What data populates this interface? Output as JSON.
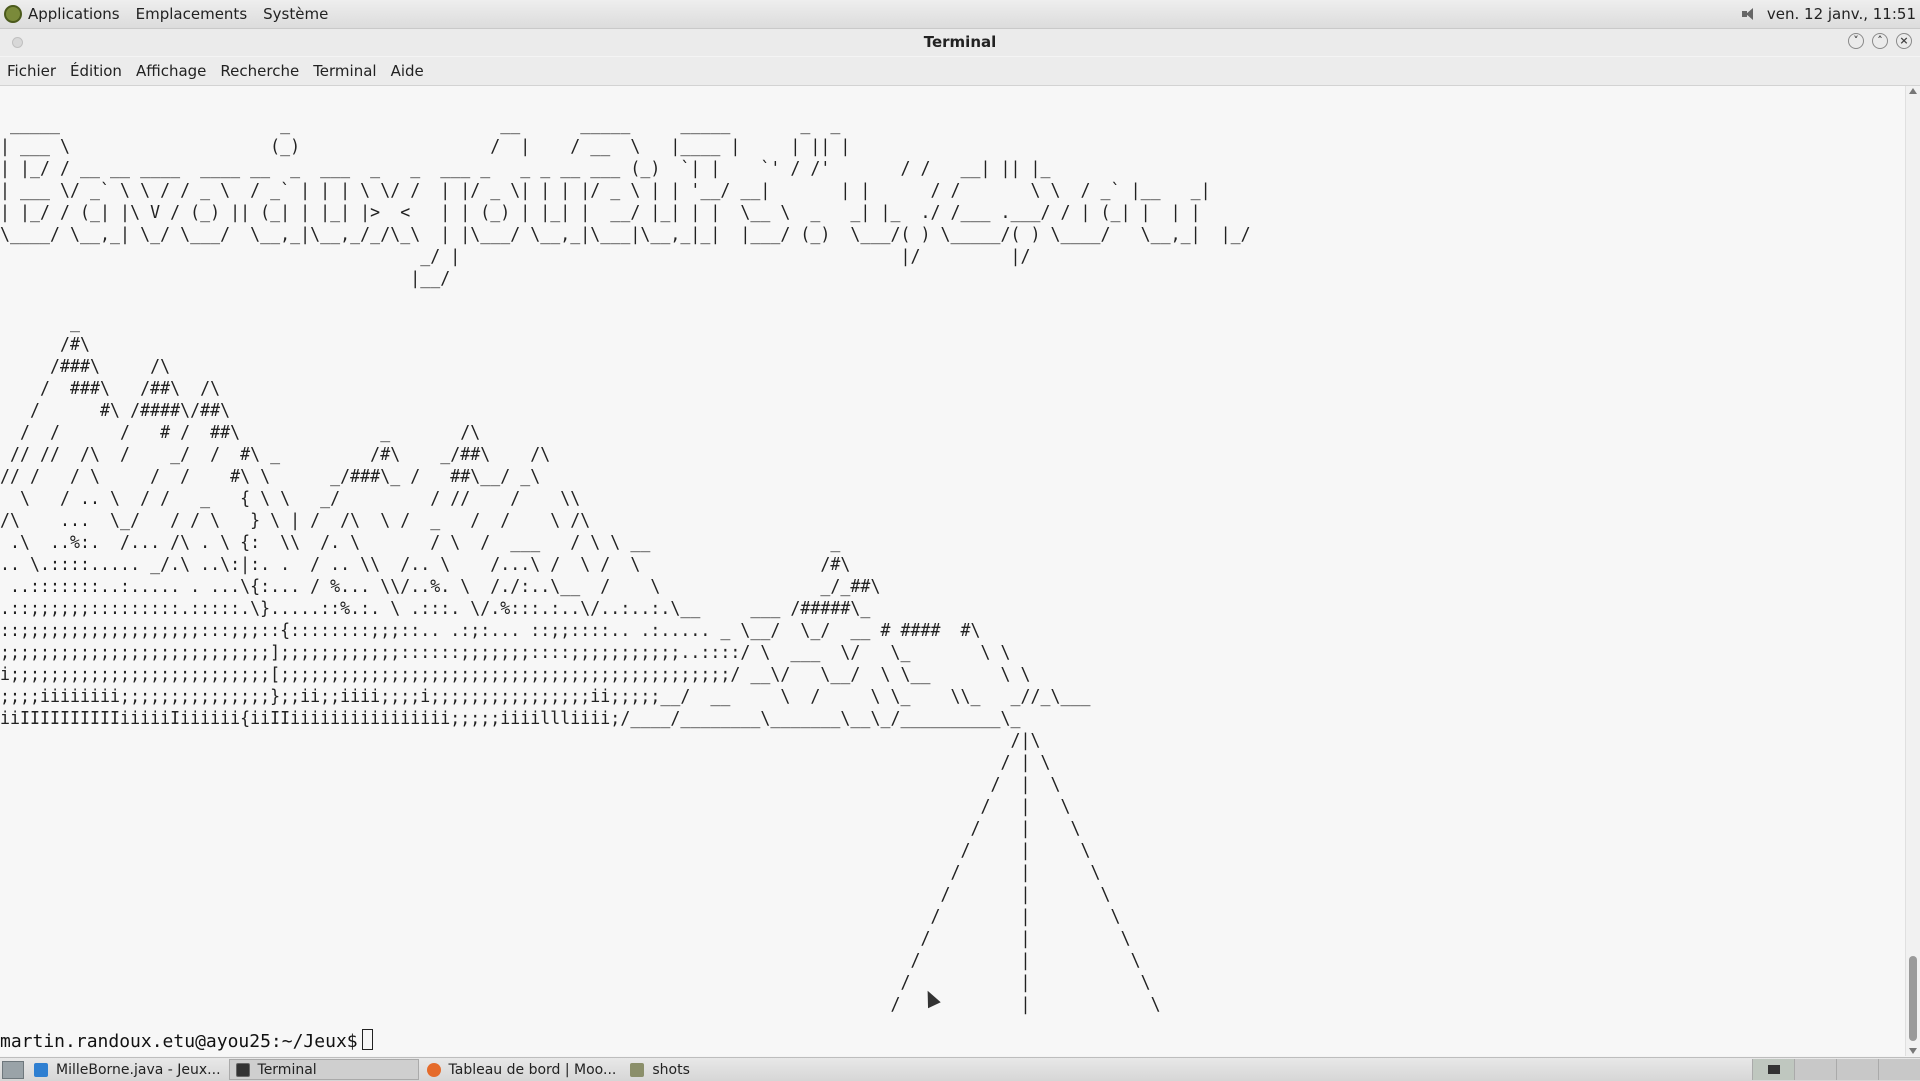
{
  "top_panel": {
    "menus": [
      "Applications",
      "Emplacements",
      "Système"
    ],
    "datetime": "ven. 12 janv., 11:51",
    "icons": [
      "gnome-foot-icon",
      "volume-icon"
    ]
  },
  "window": {
    "title": "Terminal",
    "buttons": [
      "minimize",
      "maximize",
      "close"
    ]
  },
  "menubar": [
    "Fichier",
    "Édition",
    "Affichage",
    "Recherche",
    "Terminal",
    "Aide"
  ],
  "terminal": {
    "output": " _____                      _                     __      _____     _____       _  _    \n| ___ \\                    (_)                   /  |    / __  \\   |____ |     | || |   \n| |_/ / __ __ ____  ____ __  _  ___  _   _  ___ _   _ _ __ ___ (_)  `| |    `' / /'       / /   __| || |_  \n| ___ \\/ _` \\ \\ / / _ \\  / _` | | | \\ \\/ /  | |/ _ \\| | | |/ _ \\ | | '__/ __|       | |      / /       \\ \\  / _` |__   _| \n| |_/ / (_| |\\ V / (_) || (_| | |_| |>  <   | | (_) | |_| |  __/ |_| | |  \\__ \\  _   _| |_  ./ /___ .___/ / | (_| |  | |   \n\\____/ \\__,_| \\_/ \\___/  \\__,_|\\__,_/_/\\_\\  | |\\___/ \\__,_|\\___|\\__,_|_|  |___/ (_)  \\___/( ) \\_____/( ) \\____/   \\__,_|  |_/   \n                                          _/ |                                            |/         |/                         \n                                         |__/                                                                                   \n\n       _\n      /#\\\n     /###\\     /\\\n    /  ###\\   /##\\  /\\\n   /      #\\ /####\\/##\\\n  /  /      /   # /  ##\\              _       /\\\n // //  /\\  /    _/  /  #\\ _         /#\\    _/##\\    /\\\n// /   / \\     /  /    #\\ \\      _/###\\_ /   ##\\__/ _\\\n  \\   / .. \\  / /   _   { \\ \\   _/         / //    /    \\\\\n/\\    ...  \\_/   / / \\   } \\ | /  /\\  \\ /  _   /  /    \\ /\\\n .\\  ..%:.  /... /\\ . \\ {:  \\\\  /. \\       / \\  /  ___   / \\ \\ __                  _\n.. \\.::::..... _/.\\ ..\\:|:. .  / .. \\\\  /.. \\    /...\\ /  \\ /  \\                  /#\\\n ..:::::::..:..... . ...\\{:... / %... \\\\/..%. \\  /./:..\\__  /    \\                _/_##\\\n.::;;;;;;:::::::::.:::::.\\}.....::%.:. \\ .:::. \\/.%:::.:..\\/..:..:.\\__     ___ /#####\\_\n::;;;;;;;;;;;;;;;;;;:::;;;::{::::::::;;;::.. .:;:... ::;;::::.. .:..... _ \\__/  \\_/  __ # ####  #\\\n;;;;;;;;;;;;;;;;;;;;;;;;;;;];;;;;;;;;;;;::::::;;;;;;;::::;;;;;;;;;;;..::::/ \\  ___  \\/   \\_       \\ \\\ni;;;;;;;;;;;;;;;;;;;;;;;;;;[;;;;;;;;;;;;;;;;;;;;;;;;;;;;;;;;;;;;;;;;;;;;;/ __\\/   \\__/  \\ \\__       \\ \\\n;;;;iiiiiiii;;;;;;;;;;;;;;;};;ii;;iiii;;;;i;;;;;;;;;;;;;;;;ii;;;;;__/  __     \\  /     \\ \\_    \\\\_   _//_\\___\niiIIIIIIIIIIiiiiiIiiiiii{iiIIiiiiiiiiiiiiiiii;;;;;iiiillliiii;/____/________\\_______\\__\\_/__________\\_\n                                                                                                     /|\\\n                                                                                                    / | \\\n                                                                                                   /  |  \\\n                                                                                                  /   |   \\\n                                                                                                 /    |    \\\n                                                                                                /     |     \\\n                                                                                               /      |      \\\n                                                                                              /       |       \\\n                                                                                             /        |        \\\n                                                                                            /         |         \\\n                                                                                           /          |          \\\n                                                                                          /           |           \\\n                                                                                         /            |            \\",
    "prompt": "martin.randoux.etu@ayou25:~/Jeux$"
  },
  "taskbar": {
    "tasks": [
      {
        "label": "MilleBorne.java - Jeux...",
        "icon": "vscode-icon"
      },
      {
        "label": "Terminal",
        "icon": "terminal-icon"
      },
      {
        "label": "Tableau de bord | Moo...",
        "icon": "firefox-icon"
      },
      {
        "label": "shots",
        "icon": "folder-icon"
      }
    ],
    "workspaces": 4
  }
}
